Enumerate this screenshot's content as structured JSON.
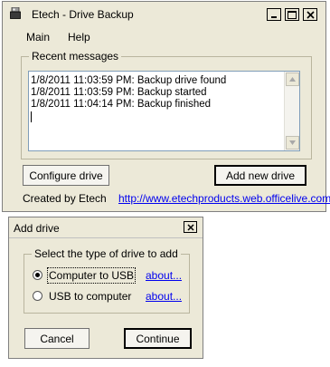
{
  "main_window": {
    "title": "Etech - Drive Backup",
    "menu": [
      "Main",
      "Help"
    ],
    "messages_group_label": "Recent messages",
    "messages": [
      "1/8/2011 11:03:59 PM: Backup drive found",
      "1/8/2011 11:03:59 PM: Backup started",
      "1/8/2011 11:04:14 PM: Backup finished"
    ],
    "configure_button": "Configure drive",
    "add_button": "Add new drive",
    "credit": "Created by Etech",
    "website": "http://www.etechproducts.web.officelive.com"
  },
  "add_dialog": {
    "title": "Add drive",
    "group_label": "Select the type of drive to add",
    "options": [
      {
        "label": "Computer to USB",
        "link": "about...",
        "checked": true
      },
      {
        "label": "USB to computer",
        "link": "about...",
        "checked": false
      }
    ],
    "cancel_button": "Cancel",
    "continue_button": "Continue"
  },
  "icons": {
    "app": "usb-drive-icon",
    "minimize": "minimize-icon",
    "maximize": "maximize-icon",
    "close": "close-icon",
    "scroll_up": "arrow-up-icon",
    "scroll_down": "arrow-down-icon"
  }
}
